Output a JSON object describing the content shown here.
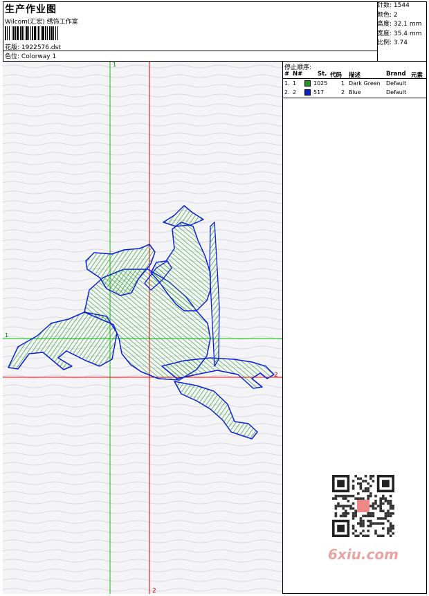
{
  "header": {
    "title": "生产作业图",
    "company": "Wilcom(汇宏) 绣饰工作室",
    "design_label": "花版:",
    "design_value": "1922576.dst",
    "color_label": "色位:",
    "color_value": "Colorway 1"
  },
  "stats": {
    "stitches_label": "针数:",
    "stitches": "1544",
    "colors_label": "颜色:",
    "colors": "2",
    "height_label": "高度:",
    "height": "32.1 mm",
    "width_label": "宽度:",
    "width": "35.4 mm",
    "scale_label": "比例:",
    "scale": "3.74"
  },
  "stop_sequence": {
    "title": "停止顺序:",
    "columns": [
      "#",
      "N#",
      "St.",
      "代码",
      "描述",
      "Brand",
      "元素"
    ],
    "rows": [
      {
        "index": "1.",
        "n": "1",
        "color": "#1a9a1a",
        "stitches": "1025",
        "code": "1",
        "description": "Dark Green",
        "brand": "Default"
      },
      {
        "index": "2.",
        "n": "2",
        "color": "#0a1ed8",
        "stitches": "517",
        "code": "2",
        "description": "Blue",
        "brand": "Default"
      }
    ]
  },
  "canvas": {
    "marker_top": "1",
    "marker_left": "1",
    "marker_bottom": "2",
    "marker_right": "2"
  },
  "watermark": "6xiu.com",
  "colors": {
    "green_axis": "#00c000",
    "red_axis": "#e00000",
    "thread_green": "#1a9a1a",
    "thread_blue": "#0a1ed8"
  }
}
